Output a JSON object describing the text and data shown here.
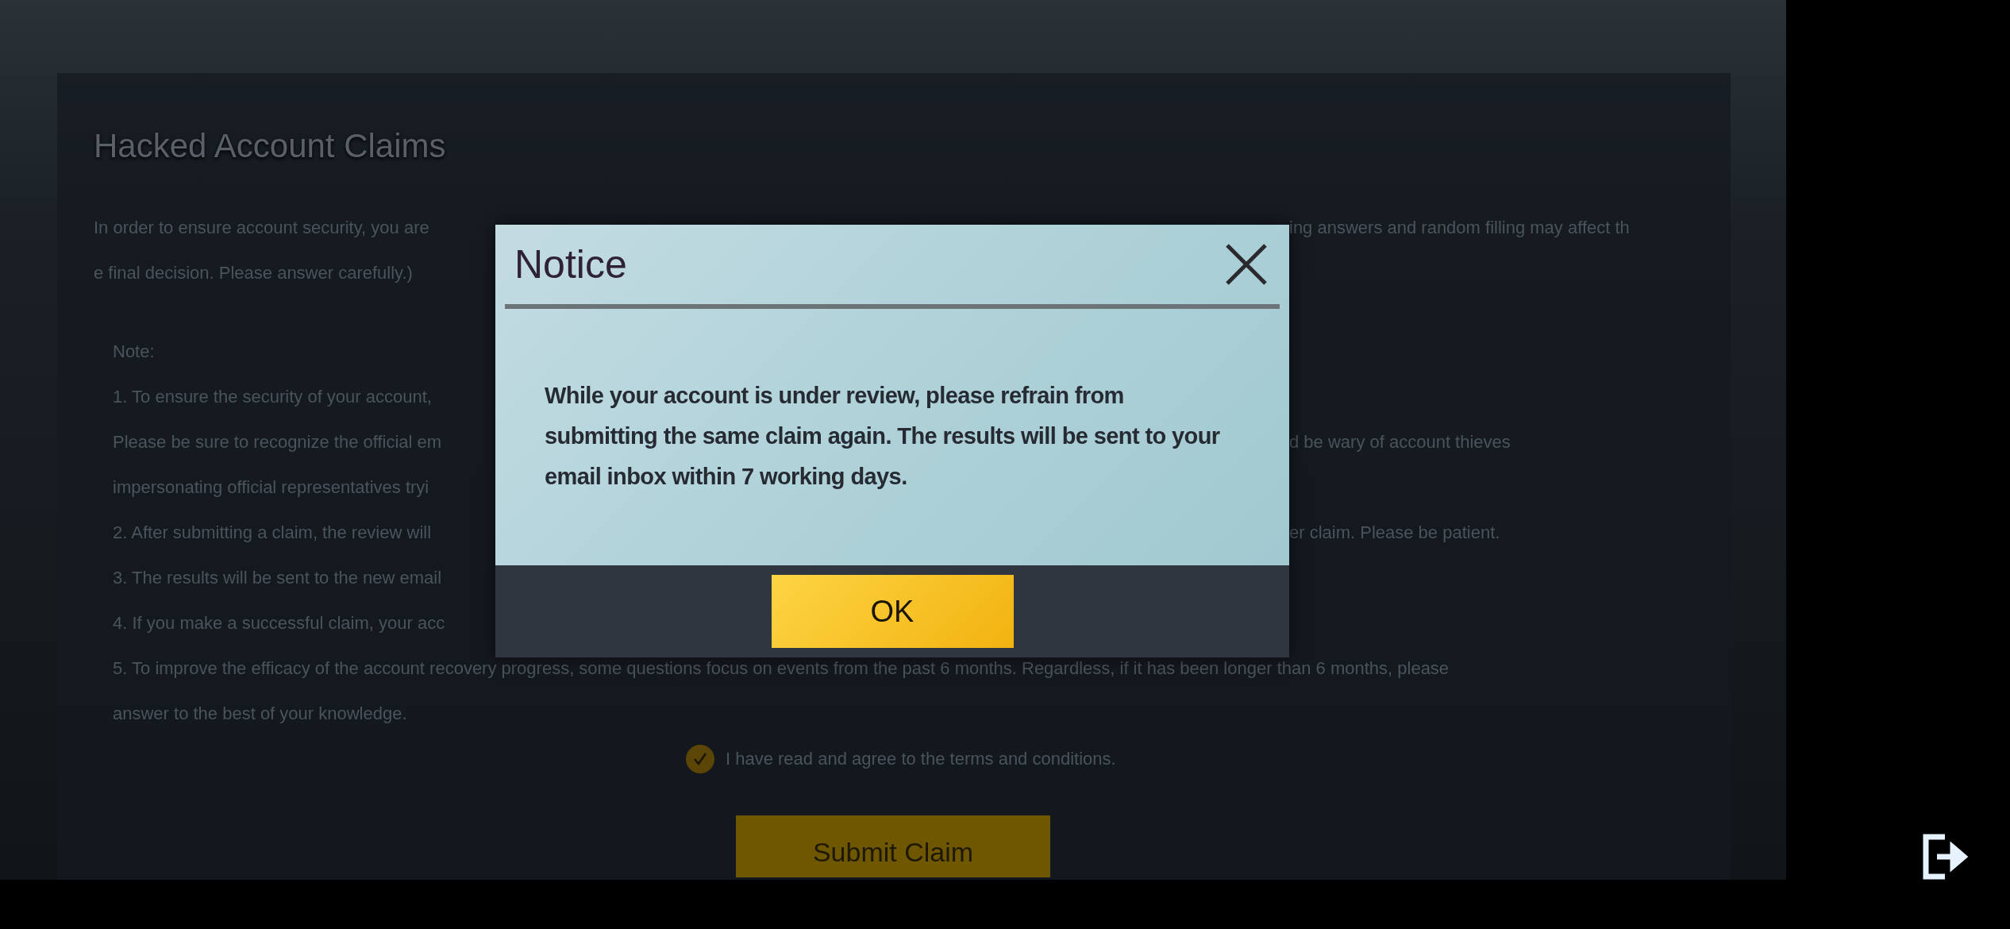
{
  "page": {
    "title": "Hacked Account Claims",
    "intro": [
      {
        "kind": "split",
        "left": "In order to ensure account security, you are",
        "right": "ing answers and random filling may affect th"
      },
      {
        "kind": "full",
        "text": "e final decision. Please answer carefully.)"
      }
    ],
    "note_heading": "Note:",
    "notes": [
      {
        "kind": "split",
        "left": "1. To ensure the security of your account,"
      },
      {
        "kind": "split",
        "left": "Please be sure to recognize the official em",
        "right": "d be wary of account thieves"
      },
      {
        "kind": "split",
        "left": "impersonating official representatives tryi"
      },
      {
        "kind": "split",
        "left": "2. After submitting a claim, the review will",
        "right": "er claim. Please be patient."
      },
      {
        "kind": "split",
        "left": "3. The results will be sent to the new email"
      },
      {
        "kind": "split",
        "left": "4. If you make a successful claim, your acc"
      },
      {
        "kind": "full",
        "text": "5. To improve the efficacy of the account recovery progress, some questions focus on events from the past 6 months. Regardless, if it has been longer than 6 months, please"
      },
      {
        "kind": "full",
        "text": "answer to the best of your knowledge."
      }
    ],
    "agreement": {
      "checked": true,
      "label": "I have read and agree to the terms and conditions."
    },
    "submit_button": "Submit Claim"
  },
  "dialog": {
    "title": "Notice",
    "message": "While your account is under review, please refrain from submitting the same claim again. The results will be sent to your email inbox within 7 working days.",
    "ok_button": "OK"
  }
}
